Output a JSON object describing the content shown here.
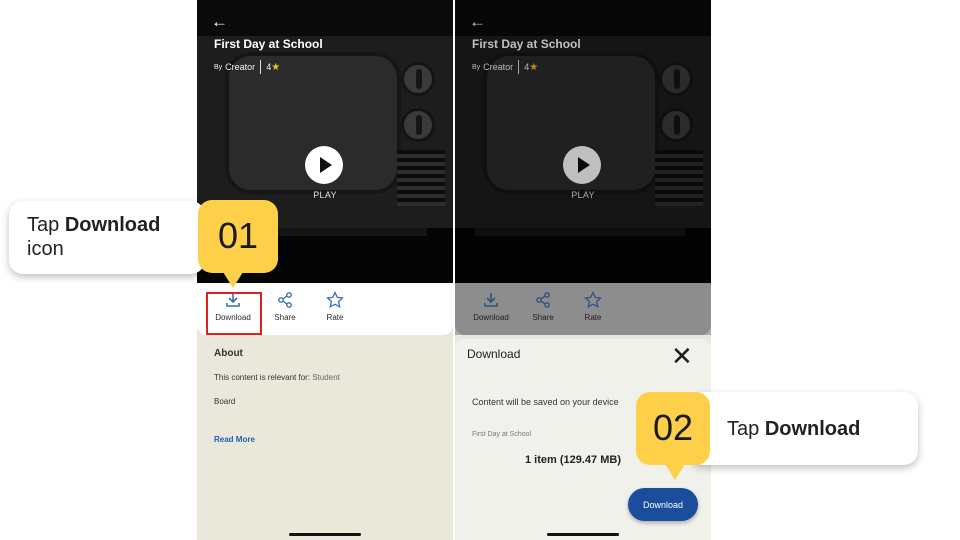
{
  "colors": {
    "callout_yellow": "#fecf49",
    "highlight_red": "#e02020",
    "download_button_blue": "#1a4e9c",
    "rating_star": "#f2c21b"
  },
  "screen1": {
    "title": "First Day at School",
    "by_prefix": "By",
    "creator": "Creator",
    "rating": "4",
    "play_label": "PLAY",
    "actions": {
      "download": "Download",
      "share": "Share",
      "rate": "Rate"
    },
    "about_heading": "About",
    "relevant_label": "This content is relevant for:",
    "relevant_value": "Student",
    "board_label": "Board",
    "read_more": "Read More"
  },
  "screen2": {
    "title": "First Day at School",
    "by_prefix": "By",
    "creator": "Creator",
    "rating": "4",
    "play_label": "PLAY",
    "actions": {
      "download": "Download",
      "share": "Share",
      "rate": "Rate"
    },
    "sheet": {
      "title": "Download",
      "message": "Content will be saved on your device",
      "item_name": "First Day at School",
      "size_summary": "1 item (129.47 MB)",
      "button": "Download"
    }
  },
  "callouts": {
    "step1": {
      "prefix": "Tap ",
      "bold": "Download",
      "suffix": "icon",
      "number": "01"
    },
    "step2": {
      "prefix": "Tap ",
      "bold": "Download",
      "number": "02"
    }
  }
}
